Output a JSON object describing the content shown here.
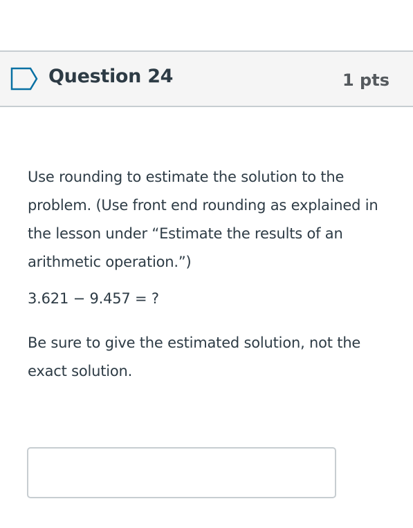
{
  "question": {
    "title": "Question 24",
    "points": "1 pts",
    "flag_icon": "flag-outline-icon",
    "paragraphs": [
      "Use rounding to estimate the solution to the problem. (Use front end rounding as explained in the lesson under “Estimate the results of an arithmetic operation.”)",
      "3.621 − 9.457 = ?",
      "Be sure to give the estimated solution, not the exact solution."
    ]
  },
  "answer": {
    "value": "",
    "placeholder": ""
  },
  "colors": {
    "header_background": "#f5f5f5",
    "border": "#c7cdd1",
    "flag_stroke": "#0770a3",
    "text": "#2d3b45",
    "points_text": "#555a5e"
  }
}
